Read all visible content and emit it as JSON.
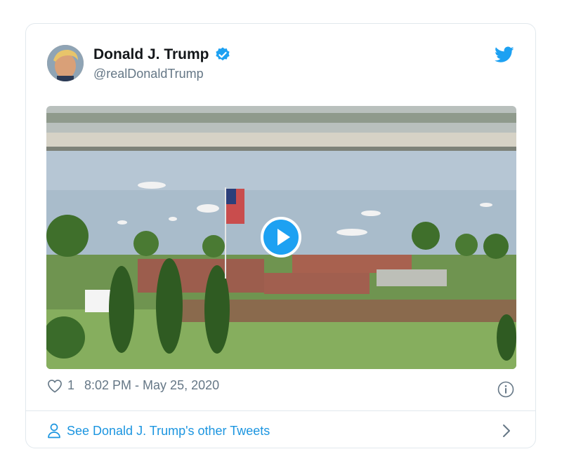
{
  "tweet": {
    "author_name": "Donald J. Trump",
    "author_handle": "@realDonaldTrump",
    "like_count": "1",
    "timestamp": "8:02 PM - May 25, 2020",
    "footer_link": "See Donald J. Trump's other Tweets"
  },
  "colors": {
    "accent": "#1da1f2",
    "link": "#1b95e0",
    "secondary_text": "#657786",
    "border": "#e1e8ed"
  },
  "icons": [
    "verified-badge-icon",
    "twitter-bird-icon",
    "play-icon",
    "heart-icon",
    "info-icon",
    "person-icon",
    "chevron-right-icon"
  ]
}
